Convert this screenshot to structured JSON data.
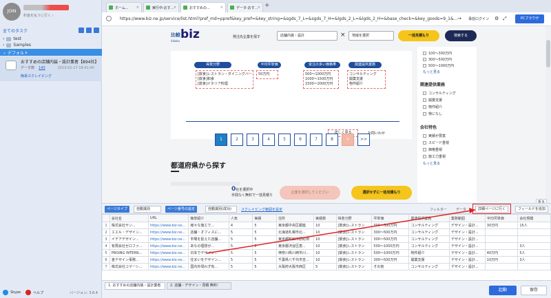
{
  "sidebar": {
    "profile_label": "JOIN",
    "user_line": "料金を払うに行く ›",
    "section_title": "全てのタスク",
    "folders": [
      "test",
      "Samples"
    ],
    "active_folder": "デフォルト",
    "task": {
      "title": "おすすめの店舗内装・設計業者【894社】を...",
      "data_label": "データ数",
      "data_count": "143",
      "date": "2023-02-17 18:41:40",
      "mode": "簡易スクレイピング"
    },
    "footer": {
      "skype": "Skype",
      "help": "ヘルプ",
      "version": "バージョン: 3.6.4"
    }
  },
  "browser": {
    "tabs": [
      "ホーム...",
      "実行中-おす...",
      "おすすめの...",
      "データ-おす..."
    ],
    "url": "https://www.biz.ne.jp/service/list.html?pref_md=ppref&key_pref=&key_string=&sgds_7_L=&sgds_7_H=&lgds_2_L=&lgds_2_H=&base_check=&key_goods=9_1&...",
    "jizen": "事前ログイン",
    "pc_btn": "PCブラウザ"
  },
  "site": {
    "logo_small": "比較",
    "logo_big": "biz",
    "logo_sub": "hikaku",
    "search_label": "発注先企業を探す",
    "category": "店舗内装・設計",
    "area": "地域を選択",
    "estimate_btn": "一括見積もり",
    "search_btn": "検索する",
    "card": {
      "badges": [
        "得意分野",
        "平均坪単価",
        "受注の多い価格帯",
        "関連提供業務"
      ],
      "fields": [
        "[飲食]レストラン・ダイニングバー",
        "[飲食]和食",
        "[飲食]イタリア料理"
      ],
      "price": "50万円",
      "ranges": [
        "500～1000万円",
        "1000～1500万円",
        "1500～2000万円"
      ],
      "services": [
        "コンサルティング",
        "開業支援",
        "物件紹介"
      ],
      "detail": "詳しく見る",
      "inquiry": "お問いわせ"
    },
    "filter": {
      "price_items": [
        "100～300万円",
        "300～500万円",
        "500～1000万円"
      ],
      "more": "もっと見る",
      "related_head": "関連提供業務",
      "related_items": [
        "コンサルティング",
        "開業支援",
        "物件紹介",
        "特になし"
      ],
      "feature_head": "会社特色",
      "feature_items": [
        "実績が豊富",
        "スピード重視",
        "価格重視",
        "施工力重視"
      ]
    },
    "pages": [
      "1",
      "2",
      "3",
      "4",
      "5",
      "6",
      "7",
      "8",
      ">",
      ">>"
    ],
    "pref_title": "都道府県から探す",
    "selected_count": "0",
    "selected_suffix": "社を選択中",
    "selected_sub": "手間なく無料で一括見積り",
    "select_company_btn": "企業を選択してください",
    "bulk_btn": "選択せずに一括見積もり"
  },
  "toolbar": {
    "page_type_label": "ページタイプ",
    "page_type_value": "自動識別",
    "page_turn_label": "ページ番号の設定",
    "page_turn_value": "自動識別(成功)",
    "scroll_link": "スクレイピング範囲を設定",
    "filter_btn": "フィルター",
    "data_btn": "データ",
    "detail_btn": "詳細ページに行く",
    "add_field_btn": "フィールドを追加",
    "fold": "折る"
  },
  "table": {
    "columns": [
      "",
      "会社名",
      "URL",
      "簡単紹介",
      "人気",
      "実績",
      "住所",
      "実績数",
      "得意分野",
      "坪単価",
      "関連提供業務",
      "業務範囲",
      "平均坪単価",
      "会社規模"
    ],
    "rows": [
      [
        "1",
        "株式会社サン...",
        "https://www.biz.ne...",
        "様々な施工で...",
        "4",
        "5",
        "東京都中央区銀座",
        "10",
        "[飲食]レストラン",
        "300～500万円",
        "コンサルティング",
        "デザイン・設計...",
        "30万円",
        "15人"
      ],
      [
        "2",
        "エエル・デザイン...",
        "https://www.biz.ne...",
        "店舗・オフィスに...",
        "5",
        "5",
        "北海道札幌市北...",
        "10",
        "[飲食]レストラン",
        "300～500万円",
        "コンサルティング",
        "デザイン・設計...",
        "",
        ""
      ],
      [
        "3",
        "イデアデザイン...",
        "https://www.biz.ne...",
        "市場を捉えた店舗...",
        "5",
        "5",
        "東京都町田市原町田",
        "10",
        "[飲食]レストラン",
        "300～500万円",
        "コンサルティング",
        "デザイン・設計...",
        "",
        ""
      ],
      [
        "4",
        "有限会社ゼロファ...",
        "https://www.biz.ne...",
        "あなの理想が...",
        "5",
        "5",
        "東京都渋谷区恵...",
        "10",
        "[飲食]レストラン",
        "500～1000万円",
        "コンサルティング",
        "デザイン・設計...",
        "",
        "3人"
      ],
      [
        "5",
        "PROING INTERN...",
        "https://www.biz.ne...",
        "日本でデザイン...",
        "5",
        "5",
        "神奈川県川崎市川...",
        "10",
        "[飲食]レストラン",
        "500～1000万円",
        "物件紹介",
        "デザイン・設計...",
        "40万円",
        "5人"
      ],
      [
        "6",
        "金デザイン事務...",
        "https://www.biz.ne...",
        "住まいをデザイン...",
        "5",
        "5",
        "千葉県八千代市吉...",
        "10",
        "[飲食]レストラン",
        "300～500万円",
        "開業支援",
        "デザイン・設計...",
        "10万円",
        "3人"
      ],
      [
        "7",
        "株式会社コマーシ...",
        "https://www.biz.ne...",
        "国内外問わず有...",
        "5",
        "5",
        "大阪府大阪市西区",
        "5",
        "[飲食]レストラン",
        "その他",
        "コンサルティング",
        "デザイン・設計...",
        "",
        ""
      ]
    ]
  },
  "bottom": {
    "tab1": "1. おすすめの店舗内装・設計業者",
    "tab2": "2. 店舗 - デザイン・見積 無料!",
    "run": "起動",
    "save": "保存"
  }
}
